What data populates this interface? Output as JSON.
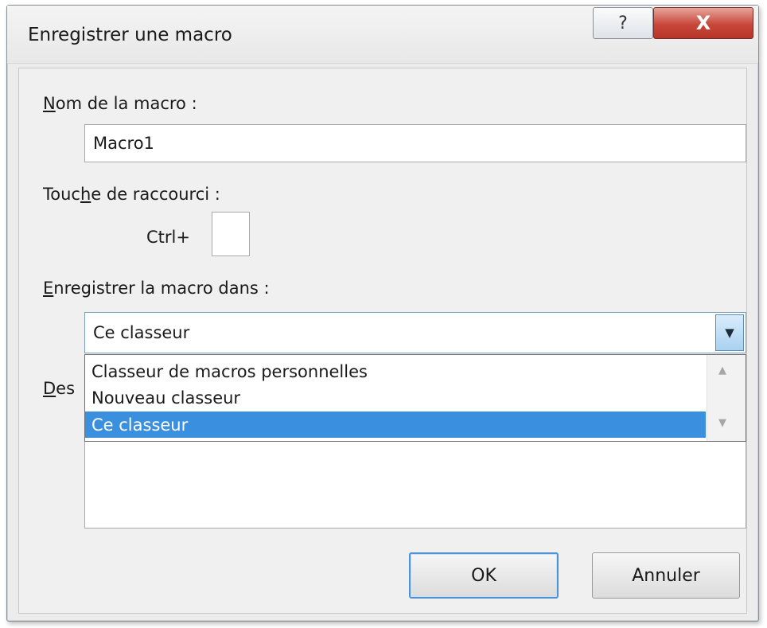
{
  "window": {
    "title": "Enregistrer une macro",
    "help_glyph": "?",
    "close_glyph": "X"
  },
  "form": {
    "name_label_ul": "N",
    "name_label_rest": "om de la macro :",
    "name_value": "Macro1",
    "shortcut_label_pre": "Touc",
    "shortcut_label_ul": "h",
    "shortcut_label_rest": "e de raccourci :",
    "ctrl_prefix": "Ctrl+",
    "shortcut_value": "",
    "store_label_ul": "E",
    "store_label_rest": "nregistrer la macro dans :",
    "store_selected": "Ce classeur",
    "description_label_ul": "D",
    "description_label_rest": "es",
    "description_value": ""
  },
  "dropdown": {
    "options": [
      "Classeur de macros personnelles",
      "Nouveau classeur",
      "Ce classeur"
    ],
    "selected_index": 2
  },
  "buttons": {
    "ok": "OK",
    "cancel": "Annuler"
  },
  "icons": {
    "combo_arrow": "chevron-down-icon",
    "scroll_up": "triangle-up-icon",
    "scroll_down": "triangle-down-icon"
  },
  "colors": {
    "selection": "#3a8fde",
    "close_button": "#c7473a",
    "default_button_border": "#4f93d3"
  }
}
